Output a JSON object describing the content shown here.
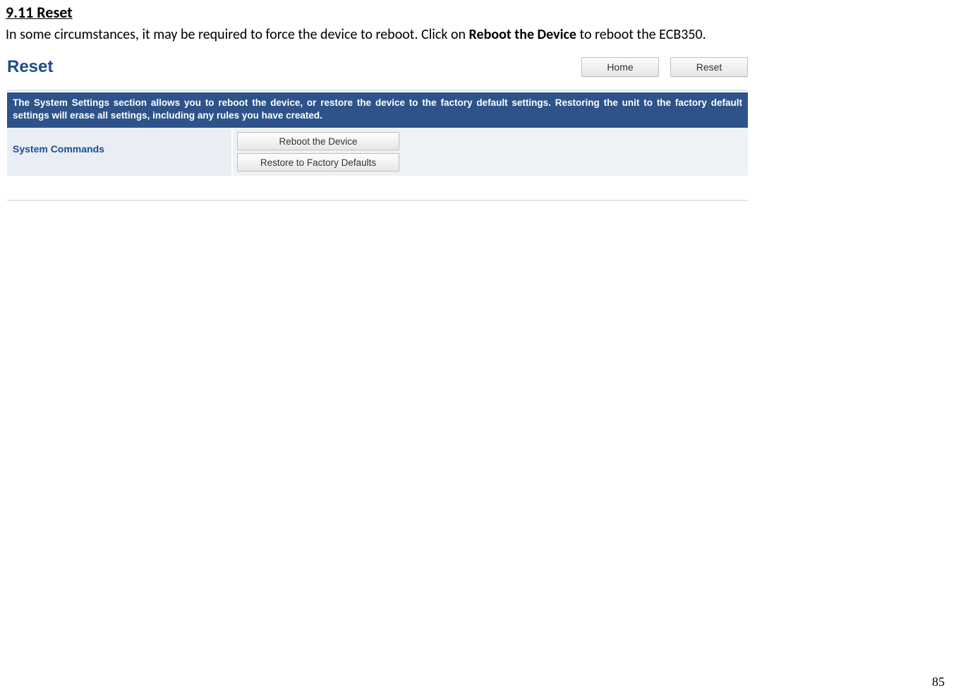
{
  "heading": "9.11 Reset",
  "intro": {
    "pre": "In some circumstances, it may be required to force the device to reboot. Click on ",
    "bold": "Reboot the Device",
    "post": " to reboot the ECB350."
  },
  "panel": {
    "title": "Reset",
    "nav": {
      "home": "Home",
      "reset": "Reset"
    },
    "info_text": "The System Settings section allows you to reboot the device, or restore the device to the factory default settings. Restoring the unit to the factory default settings will erase all settings, including any rules you have created.",
    "row_label": "System Commands",
    "buttons": {
      "reboot": "Reboot the Device",
      "restore": "Restore to Factory Defaults"
    }
  },
  "page_number": "85"
}
